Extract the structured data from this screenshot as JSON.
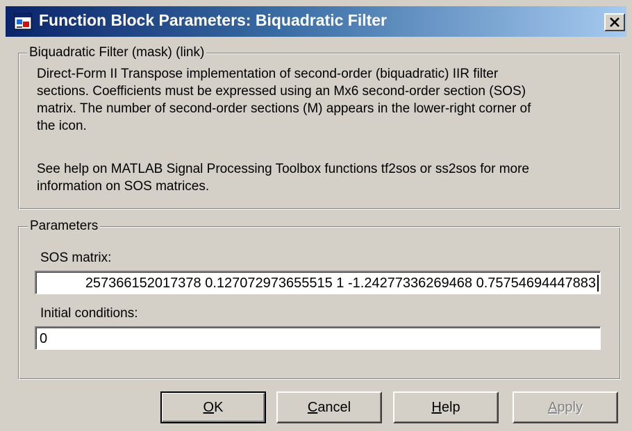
{
  "window": {
    "title": "Function Block Parameters: Biquadratic Filter",
    "close_icon": "close-icon"
  },
  "description_group": {
    "title": "Biquadratic Filter (mask) (link)",
    "paragraph1_lines": [
      "Direct-Form II Transpose implementation of second-order (biquadratic) IIR filter",
      "sections.  Coefficients must be expressed using an Mx6 second-order section (SOS)",
      "matrix.  The number of second-order sections (M) appears in the lower-right corner of",
      "the icon."
    ],
    "paragraph2_lines": [
      "See help on MATLAB Signal Processing Toolbox functions tf2sos or ss2sos for more",
      "information on SOS matrices."
    ]
  },
  "parameters_group": {
    "title": "Parameters",
    "sos_label": "SOS matrix:",
    "sos_value": "257366152017378 0.127072973655515 1 -1.24277336269468 0.75754694447883",
    "ic_label": "Initial conditions:",
    "ic_value": "0"
  },
  "buttons": {
    "ok": {
      "mnemonic": "O",
      "rest": "K"
    },
    "cancel": {
      "mnemonic": "C",
      "rest": "ancel"
    },
    "help": {
      "mnemonic": "H",
      "rest": "elp"
    },
    "apply": {
      "mnemonic": "A",
      "rest": "pply",
      "enabled": false
    }
  }
}
